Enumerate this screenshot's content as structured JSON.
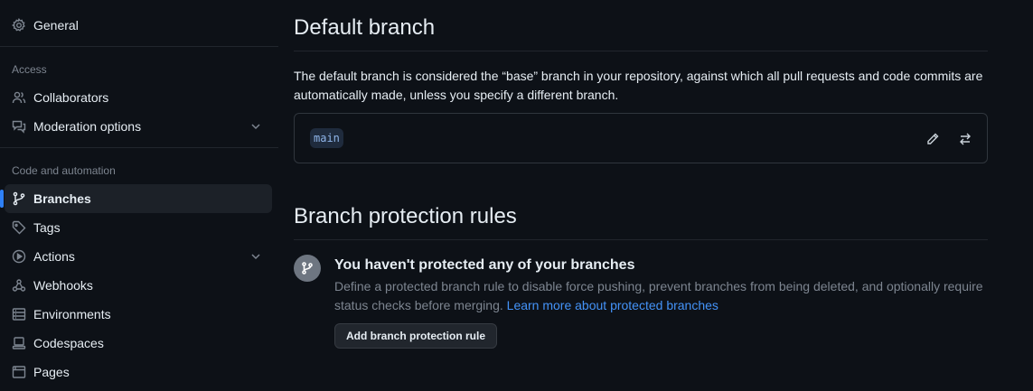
{
  "sidebar": {
    "general": "General",
    "access_label": "Access",
    "collaborators": "Collaborators",
    "moderation": "Moderation options",
    "code_label": "Code and automation",
    "branches": "Branches",
    "tags": "Tags",
    "actions": "Actions",
    "webhooks": "Webhooks",
    "environments": "Environments",
    "codespaces": "Codespaces",
    "pages": "Pages"
  },
  "default_branch": {
    "title": "Default branch",
    "description": "The default branch is considered the “base” branch in your repository, against which all pull requests and code commits are automatically made, unless you specify a different branch.",
    "branch_name": "main"
  },
  "protection": {
    "title": "Branch protection rules",
    "empty_title": "You haven't protected any of your branches",
    "empty_description": "Define a protected branch rule to disable force pushing, prevent branches from being deleted, and optionally require status checks before merging.",
    "learn_more": "Learn more about protected branches",
    "add_button": "Add branch protection rule"
  },
  "colors": {
    "background": "#0d1117",
    "accent": "#2f81f7",
    "link": "#4493f8"
  },
  "icons": [
    "gear-icon",
    "people-icon",
    "comment-discussion-icon",
    "git-branch-icon",
    "tag-icon",
    "play-icon",
    "webhook-icon",
    "server-icon",
    "codespaces-icon",
    "browser-icon",
    "pencil-icon",
    "arrow-switch-icon"
  ]
}
